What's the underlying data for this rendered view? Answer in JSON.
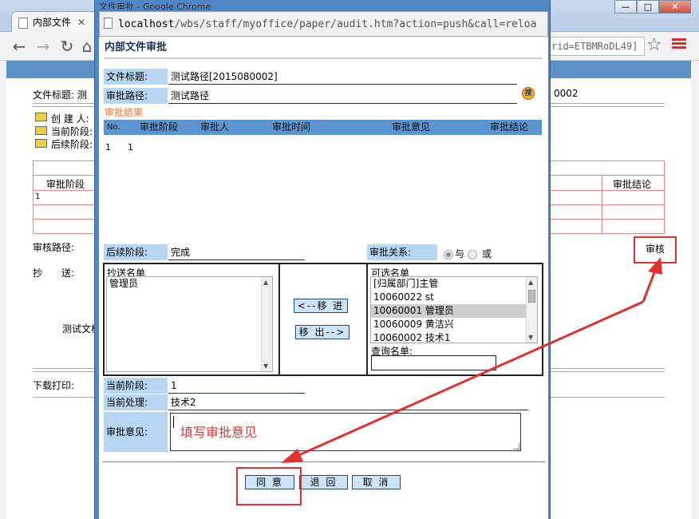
{
  "background": {
    "tab_title": "内部文件",
    "url_tail": "rid=ETBMRoDL49]",
    "window_controls": [
      "—",
      "□",
      "✕"
    ],
    "page_number": "0002",
    "labels": {
      "file_title": "文件标题: 测",
      "creator": "创 建 人:",
      "current_stage": "当前阶段:",
      "next_stage": "后续阶段:",
      "audit_stage_col": "审批阶段",
      "audit_result_col": "审批结论",
      "row_no": "1",
      "audit_path": "审核路径:",
      "cc": "抄　　送:",
      "doc_text": "测试文档",
      "download": "下载打印:"
    },
    "audit_button": "审核"
  },
  "dialog": {
    "window_title": "文件审批 - Google Chrome",
    "url_host": "localhost",
    "url_path": "/wbs/staff/myoffice/paper/audit.htm?action=push&call=reloa",
    "heading": "内部文件审批",
    "file_title_label": "文件标题:",
    "file_title_value": "测试路径[2015080002]",
    "audit_path_label": "审批路径:",
    "audit_path_value": "测试路径",
    "search_icon_glyph": "搜",
    "results_title": "审批结果",
    "table_columns": [
      "No.",
      "审批阶段",
      "审批人",
      "审批时间",
      "审批意见",
      "审批结论"
    ],
    "table_rows": [
      [
        "1",
        "1"
      ]
    ],
    "next_stage_label": "后续阶段:",
    "next_stage_value": "完成",
    "relation_label": "审批关系:",
    "relation_and": "与",
    "relation_or": "或",
    "cc_list_title": "抄送名单",
    "cc_list": [
      "管理员"
    ],
    "move_in": "<--移 进",
    "move_out": "移 出-->",
    "candidates_title": "可选名单",
    "candidates": [
      "[归属部门]主管",
      "10060022 st",
      "10060001 管理员",
      "10060009 黄洁兴",
      "10060002 技术1"
    ],
    "candidates_selected": "10060001 管理员",
    "query_label": "查询名单:",
    "current_stage_label": "当前阶段:",
    "current_stage_value": "1",
    "current_handler_label": "当前处理:",
    "current_handler_value": "技术2",
    "opinion_label": "审批意见:",
    "opinion_hint": "填写审批意见",
    "agree_button": "同 意",
    "return_button": "退 回",
    "cancel_button": "取 消"
  },
  "colors": {
    "annotation_red": "#e03030",
    "label_bg": "#b6d6f2",
    "table_header_bg": "#5b94cf",
    "dialog_frame": "#4f86c5",
    "section_orange": "#f39a6c"
  }
}
